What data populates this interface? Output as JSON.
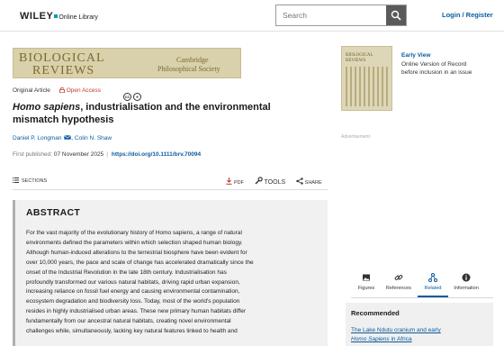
{
  "header": {
    "logo_main": "WILEY",
    "logo_sub": "Online Library",
    "search_placeholder": "Search",
    "login_label": "Login / Register"
  },
  "journal": {
    "title_line1": "BIOLOGICAL",
    "title_line2": "REVIEWS",
    "publisher_line1": "Cambridge",
    "publisher_line2": "Philosophical Society"
  },
  "article": {
    "type": "Original Article",
    "access": "Open Access",
    "title_italic": "Homo sapiens",
    "title_rest_line1": ", industrialisation and the environmental",
    "title_line2": "mismatch hypothesis",
    "authors": [
      "Daniel P. Longman",
      "Colin N. Shaw"
    ],
    "published_label": "First published:",
    "published_date": "07 November 2025",
    "doi": "https://doi.org/10.1111/brv.70094"
  },
  "toolbar": {
    "sections_label": "SECTIONS",
    "pdf_label": "PDF",
    "tools_label": "TOOLS",
    "share_label": "SHARE"
  },
  "abstract": {
    "heading": "ABSTRACT",
    "lines": [
      "For the vast majority of the evolutionary history of Homo sapiens, a range of natural",
      "environments defined the parameters within which selection shaped human biology.",
      "Although human-induced alterations to the terrestrial biosphere have been evident for",
      "over 10,000 years, the pace and scale of change has accelerated dramatically since the",
      "onset of the Industrial Revolution in the late 18th century. Industrialisation has",
      "profoundly transformed our various natural habitats, driving rapid urban expansion,",
      "increasing reliance on fossil fuel energy and causing environmental contamination,",
      "ecosystem degradation and biodiversity loss. Today, most of the world's population",
      "resides in highly industrialised urban areas. These new primary human habitats differ",
      "fundamentally from our ancestral natural habitats, creating novel environmental",
      "challenges while, simultaneously, lacking key natural features linked to health and"
    ]
  },
  "sidebar": {
    "cover_line1": "BIOLOGICAL",
    "cover_line2": "REVIEWS",
    "early_view_title": "Early View",
    "early_view_line1": "Online Version of Record",
    "early_view_line2": "before inclusion in an issue",
    "advert_label": "Advertisement",
    "tabs": [
      {
        "label": "Figures",
        "icon": "image-icon"
      },
      {
        "label": "References",
        "icon": "link-icon"
      },
      {
        "label": "Related",
        "icon": "network-icon"
      },
      {
        "label": "Information",
        "icon": "info-icon"
      }
    ],
    "active_tab": "Related",
    "recommended_heading": "Recommended",
    "recommended_link_line1": "The Lake Ndutu cranium and early",
    "recommended_link_line2_italic": "Homo Sapiens",
    "recommended_link_line2_rest": " in Africa"
  },
  "colors": {
    "link": "#0b5a9e",
    "open_access": "#c0392b",
    "banner": "#d9d0ac",
    "abstract_bg": "#f1f1f1"
  }
}
